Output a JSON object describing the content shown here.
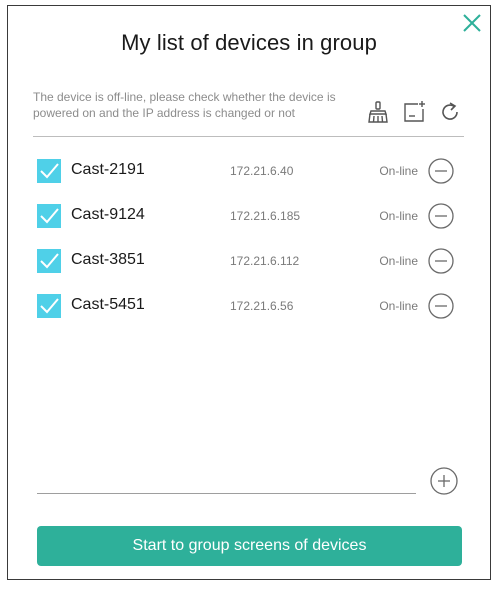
{
  "dialog": {
    "title": "My list of devices in group",
    "warning": "The device is off-line, please check whether the device is powered on and the IP address is changed or not"
  },
  "toolbar": {
    "icons": [
      "broom-icon",
      "add-screen-icon",
      "refresh-icon"
    ]
  },
  "devices": [
    {
      "name": "Cast-2191",
      "ip": "172.21.6.40",
      "status": "On-line",
      "checked": true
    },
    {
      "name": "Cast-9124",
      "ip": "172.21.6.185",
      "status": "On-line",
      "checked": true
    },
    {
      "name": "Cast-3851",
      "ip": "172.21.6.112",
      "status": "On-line",
      "checked": true
    },
    {
      "name": "Cast-5451",
      "ip": "172.21.6.56",
      "status": "On-line",
      "checked": true
    }
  ],
  "actions": {
    "start_label": "Start to group screens of devices"
  },
  "colors": {
    "accent": "#2eb09a",
    "checkbox": "#4fd0e8",
    "close": "#2eb09a"
  }
}
